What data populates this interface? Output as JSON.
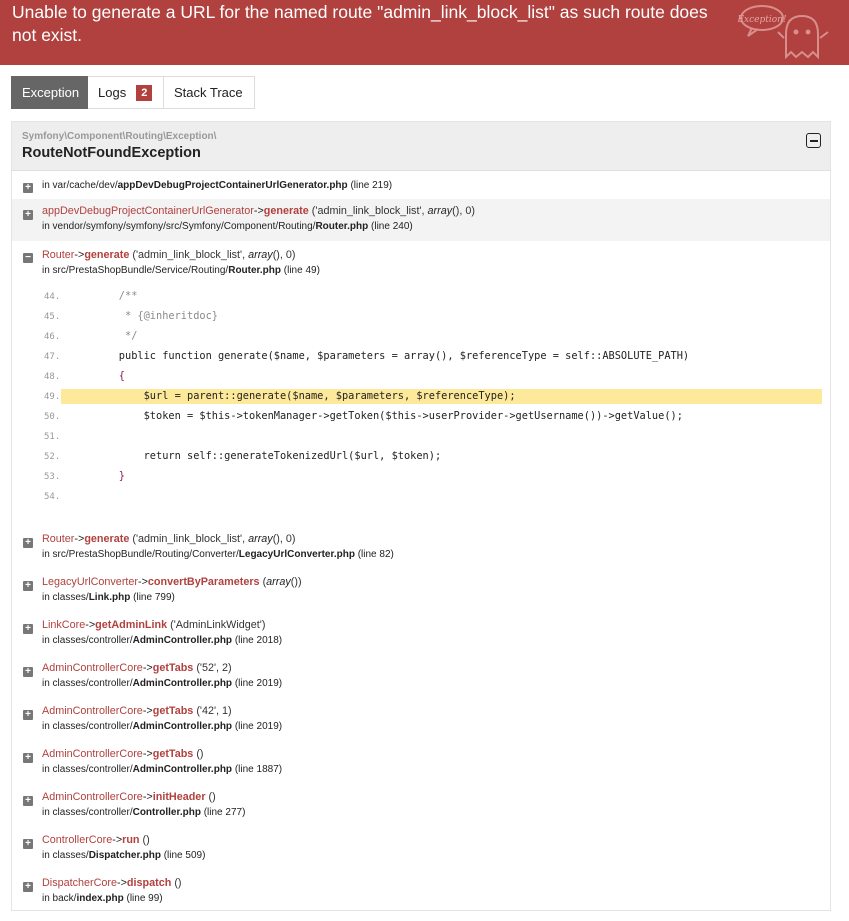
{
  "header": {
    "message": "Unable to generate a URL for the named route \"admin_link_block_list\" as such route does not exist.",
    "ghost_label": "Exception!",
    "accent_color": "#b0413e"
  },
  "tabs": [
    {
      "label": "Exception",
      "active": true
    },
    {
      "label": "Logs",
      "badge": "2"
    },
    {
      "label": "Stack Trace"
    }
  ],
  "exception": {
    "namespace": "Symfony\\Component\\Routing\\Exception\\",
    "class": "RouteNotFoundException"
  },
  "traces": [
    {
      "prefix": "in var/cache/dev/",
      "file": "appDevDebugProjectContainerUrlGenerator.php",
      "line": "(line 219)"
    },
    {
      "class": "appDevDebugProjectContainerUrlGenerator",
      "arrow": "->",
      "method": "generate",
      "args_pre": "('admin_link_block_list', ",
      "args_em": "array",
      "args_post": "(), 0)",
      "prefix": "in vendor/symfony/symfony/src/Symfony/Component/Routing/",
      "file": "Router.php",
      "line": "(line 240)"
    },
    {
      "class": "Router",
      "arrow": "->",
      "method": "generate",
      "args_pre": "('admin_link_block_list', ",
      "args_em": "array",
      "args_post": "(), 0)",
      "prefix": "in src/PrestaShopBundle/Service/Routing/",
      "file": "Router.php",
      "line": "(line 49)"
    },
    {
      "class": "Router",
      "arrow": "->",
      "method": "generate",
      "args_pre": "('admin_link_block_list', ",
      "args_em": "array",
      "args_post": "(), 0)",
      "prefix": "in src/PrestaShopBundle/Routing/Converter/",
      "file": "LegacyUrlConverter.php",
      "line": "(line 82)"
    },
    {
      "class": "LegacyUrlConverter",
      "arrow": "->",
      "method": "convertByParameters",
      "args_pre": "(",
      "args_em": "array",
      "args_post": "())",
      "prefix": "in classes/",
      "file": "Link.php",
      "line": "(line 799)"
    },
    {
      "class": "LinkCore",
      "arrow": "->",
      "method": "getAdminLink",
      "args_pre": "('AdminLinkWidget')",
      "args_em": "",
      "args_post": "",
      "prefix": "in classes/controller/",
      "file": "AdminController.php",
      "line": "(line 2018)"
    },
    {
      "class": "AdminControllerCore",
      "arrow": "->",
      "method": "getTabs",
      "args_pre": "('52', 2)",
      "args_em": "",
      "args_post": "",
      "prefix": "in classes/controller/",
      "file": "AdminController.php",
      "line": "(line 2019)"
    },
    {
      "class": "AdminControllerCore",
      "arrow": "->",
      "method": "getTabs",
      "args_pre": "('42', 1)",
      "args_em": "",
      "args_post": "",
      "prefix": "in classes/controller/",
      "file": "AdminController.php",
      "line": "(line 2019)"
    },
    {
      "class": "AdminControllerCore",
      "arrow": "->",
      "method": "getTabs",
      "args_pre": "()",
      "args_em": "",
      "args_post": "",
      "prefix": "in classes/controller/",
      "file": "AdminController.php",
      "line": "(line 1887)"
    },
    {
      "class": "AdminControllerCore",
      "arrow": "->",
      "method": "initHeader",
      "args_pre": "()",
      "args_em": "",
      "args_post": "",
      "prefix": "in classes/controller/",
      "file": "Controller.php",
      "line": "(line 277)"
    },
    {
      "class": "ControllerCore",
      "arrow": "->",
      "method": "run",
      "args_pre": "()",
      "args_em": "",
      "args_post": "",
      "prefix": "in classes/",
      "file": "Dispatcher.php",
      "line": "(line 509)"
    },
    {
      "class": "DispatcherCore",
      "arrow": "->",
      "method": "dispatch",
      "args_pre": "()",
      "args_em": "",
      "args_post": "",
      "prefix": "in back/",
      "file": "index.php",
      "line": "(line 99)"
    }
  ],
  "code": {
    "highlight_line": "49.",
    "lines": [
      {
        "no": "44.",
        "text": "    /**"
      },
      {
        "no": "45.",
        "text": "     * {@inheritdoc}"
      },
      {
        "no": "46.",
        "text": "     */"
      },
      {
        "no": "47.",
        "text": "    public function generate($name, $parameters = array(), $referenceType = self::ABSOLUTE_PATH)"
      },
      {
        "no": "48.",
        "text": "    {"
      },
      {
        "no": "49.",
        "text": "        $url = parent::generate($name, $parameters, $referenceType);"
      },
      {
        "no": "50.",
        "text": "        $token = $this->tokenManager->getToken($this->userProvider->getUsername())->getValue();"
      },
      {
        "no": "51.",
        "text": ""
      },
      {
        "no": "52.",
        "text": "        return self::generateTokenizedUrl($url, $token);"
      },
      {
        "no": "53.",
        "text": "    }"
      },
      {
        "no": "54.",
        "text": ""
      }
    ]
  }
}
